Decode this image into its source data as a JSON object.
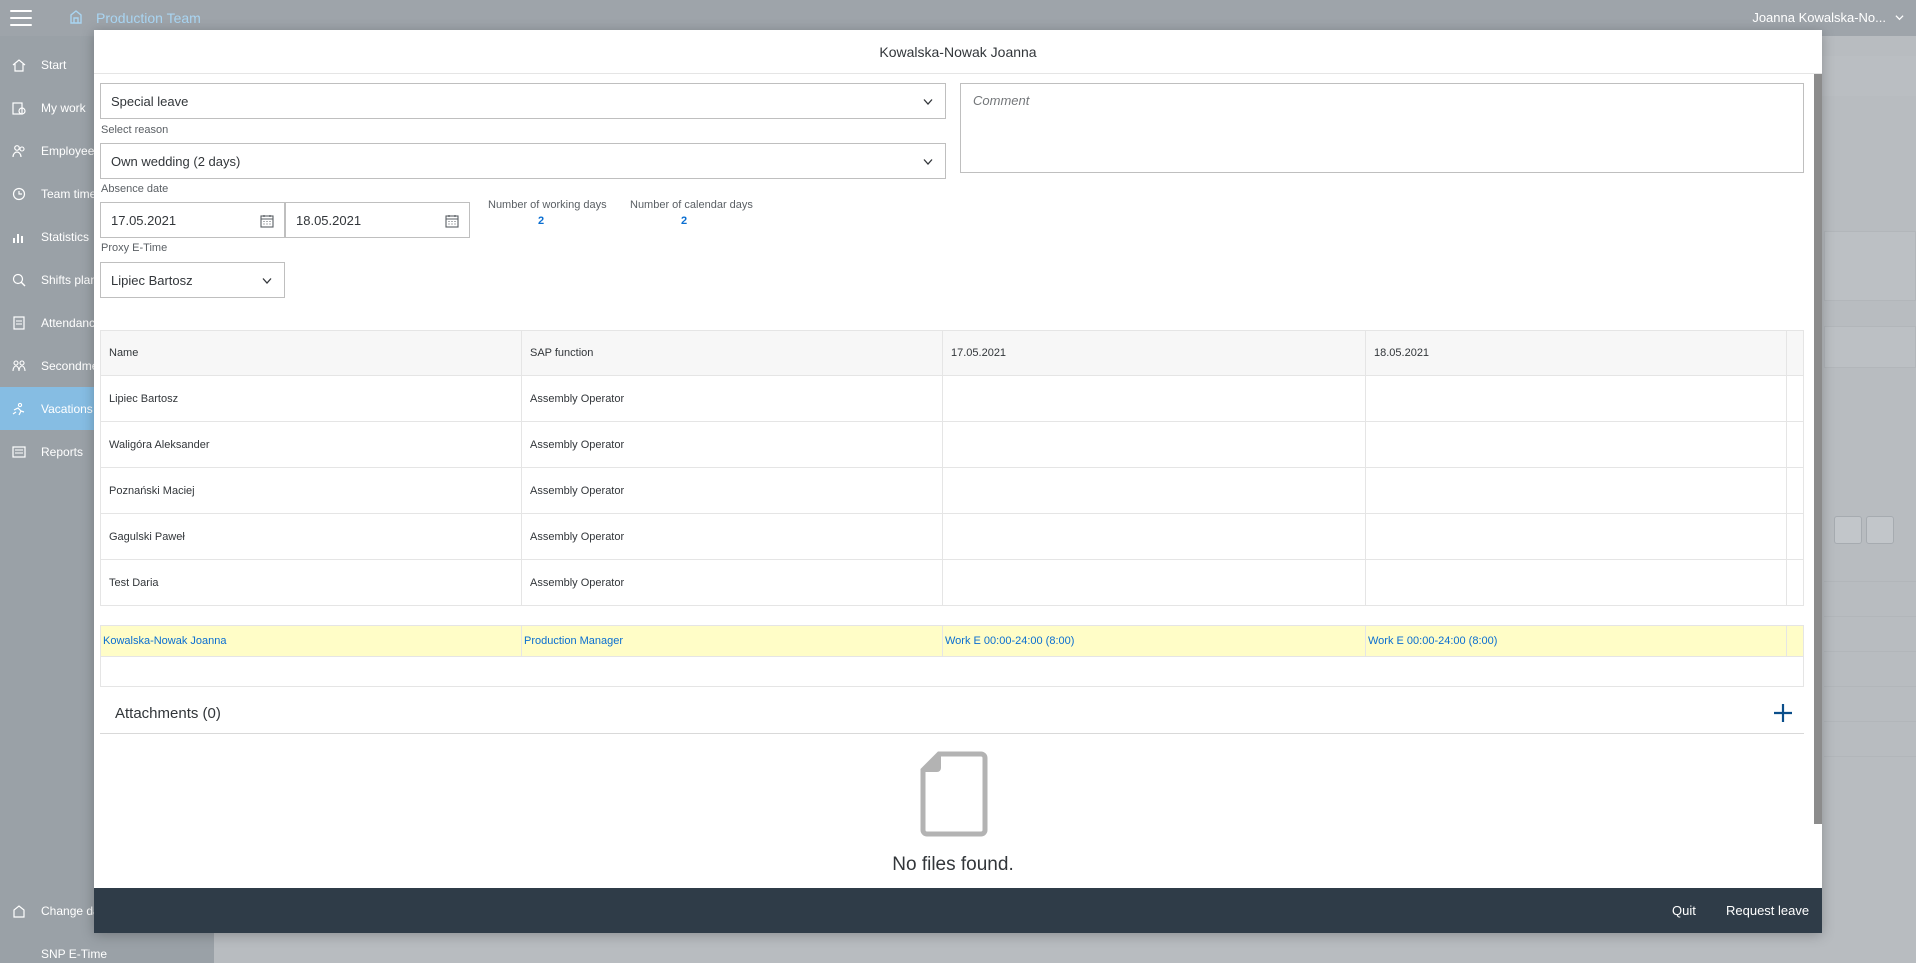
{
  "app": {
    "team_title": "Production Team",
    "user_name": "Joanna Kowalska-No...",
    "nav": [
      {
        "label": "Start",
        "icon": "home-icon"
      },
      {
        "label": "My work",
        "icon": "work-icon"
      },
      {
        "label": "Employees",
        "icon": "employees-icon"
      },
      {
        "label": "Team time",
        "icon": "team-time-icon"
      },
      {
        "label": "Statistics",
        "icon": "statistics-icon"
      },
      {
        "label": "Shifts plan",
        "icon": "shifts-icon"
      },
      {
        "label": "Attendance",
        "icon": "attendance-icon"
      },
      {
        "label": "Secondment",
        "icon": "secondment-icon"
      },
      {
        "label": "Vacations",
        "icon": "vacations-icon"
      },
      {
        "label": "Reports",
        "icon": "reports-icon"
      }
    ],
    "nav_bottom": [
      {
        "label": "Change data",
        "icon": "change-data-icon"
      },
      {
        "label": "SNP E-Time",
        "icon": ""
      }
    ]
  },
  "dialog": {
    "title": "Kowalska-Nowak Joanna",
    "leave_type": "Special leave",
    "reason_label": "Select reason",
    "reason_value": "Own wedding (2 days)",
    "comment_placeholder": "Comment",
    "absence_label": "Absence date",
    "date_from": "17.05.2021",
    "date_to": "18.05.2021",
    "working_days_label": "Number of working days",
    "working_days": "2",
    "calendar_days_label": "Number of calendar days",
    "calendar_days": "2",
    "proxy_label": "Proxy E-Time",
    "proxy_value": "Lipiec Bartosz"
  },
  "table": {
    "headers": [
      "Name",
      "SAP function",
      "17.05.2021",
      "18.05.2021"
    ],
    "rows": [
      [
        "Lipiec Bartosz",
        "Assembly Operator",
        "",
        ""
      ],
      [
        "Waligóra Aleksander",
        "Assembly Operator",
        "",
        ""
      ],
      [
        "Poznański Maciej",
        "Assembly Operator",
        "",
        ""
      ],
      [
        "Gagulski Paweł",
        "Assembly Operator",
        "",
        ""
      ],
      [
        "Test Daria",
        "Assembly Operator",
        "",
        ""
      ]
    ],
    "current": [
      "Kowalska-Nowak Joanna",
      "Production Manager",
      "Work E 00:00-24:00 (8:00)",
      "Work E 00:00-24:00 (8:00)"
    ]
  },
  "attachments": {
    "title": "Attachments (0)",
    "empty_text": "No files found."
  },
  "footer": {
    "quit_label": "Quit",
    "request_label": "Request leave"
  },
  "colors": {
    "accent": "#0a6ed1",
    "highlight_row": "#fffdc7",
    "footer_bg": "#2f3c48"
  }
}
